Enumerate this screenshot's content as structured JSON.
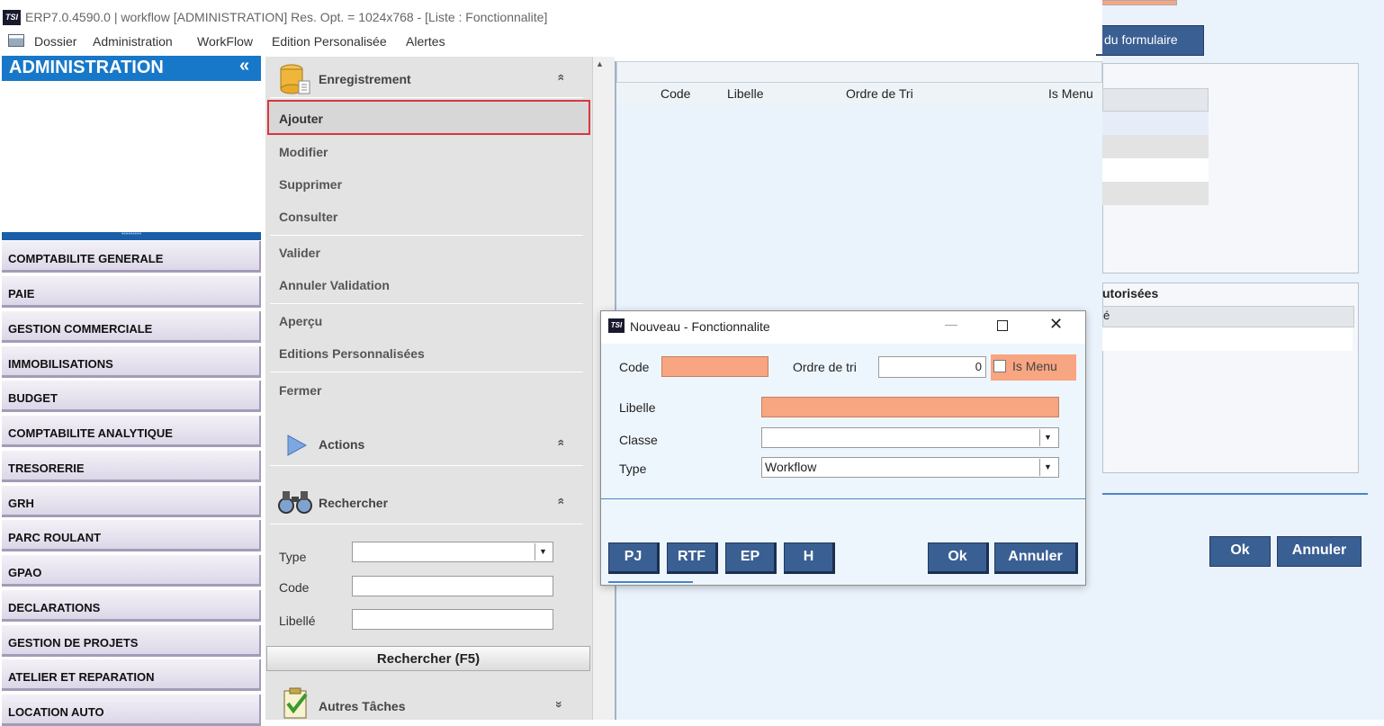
{
  "app": {
    "logo": "TSI",
    "title": "ERP7.0.4590.0 | workflow [ADMINISTRATION] Res. Opt. = 1024x768 - [Liste : Fonctionnalite]"
  },
  "menubar": [
    "Dossier",
    "Administration",
    "WorkFlow",
    "Edition Personalisée",
    "Alertes"
  ],
  "leftnav": {
    "header": "ADMINISTRATION",
    "collapse": "«",
    "splitter": "•••••••••",
    "items": [
      "COMPTABILITE GENERALE",
      "PAIE",
      "GESTION COMMERCIALE",
      "IMMOBILISATIONS",
      "BUDGET",
      "COMPTABILITE ANALYTIQUE",
      "TRESORERIE",
      "GRH",
      "PARC ROULANT",
      "GPAO",
      "DECLARATIONS",
      "GESTION DE PROJETS",
      "ATELIER ET REPARATION",
      "LOCATION AUTO"
    ]
  },
  "taskpane": {
    "enregistrement": {
      "title": "Enregistrement",
      "links": [
        "Ajouter",
        "Modifier",
        "Supprimer",
        "Consulter",
        "Valider",
        "Annuler Validation",
        "Aperçu",
        "Editions Personnalisées",
        "Fermer"
      ]
    },
    "actions": {
      "title": "Actions"
    },
    "rechercher": {
      "title": "Rechercher",
      "fields": [
        "Type",
        "Code",
        "Libellé"
      ],
      "button": "Rechercher (F5)"
    },
    "autres": {
      "title": "Autres Tâches"
    },
    "chevron_up": "»",
    "chevron_down": "»"
  },
  "list": {
    "columns": [
      "Code",
      "Libelle",
      "Ordre de Tri",
      "Is Menu"
    ]
  },
  "background": {
    "top_button": "du formulaire",
    "auth_title": "utorisées",
    "auth_col": "é",
    "ok": "Ok",
    "cancel": "Annuler"
  },
  "dialog": {
    "logo": "TSI",
    "title": "Nouveau - Fonctionnalite",
    "min": "—",
    "close": "✕",
    "fields": {
      "code_label": "Code",
      "ordre_label": "Ordre de tri",
      "ordre_value": "0",
      "ismenu_label": "Is Menu",
      "libelle_label": "Libelle",
      "classe_label": "Classe",
      "classe_value": "",
      "type_label": "Type",
      "type_value": "Workflow"
    },
    "buttons": [
      "PJ",
      "RTF",
      "EP",
      "H"
    ],
    "ok": "Ok",
    "cancel": "Annuler"
  },
  "colors": {
    "accent_blue": "#1778c9",
    "button_blue": "#3a5f93",
    "required_peach": "#f8a582",
    "highlight_red": "#d9363e"
  }
}
